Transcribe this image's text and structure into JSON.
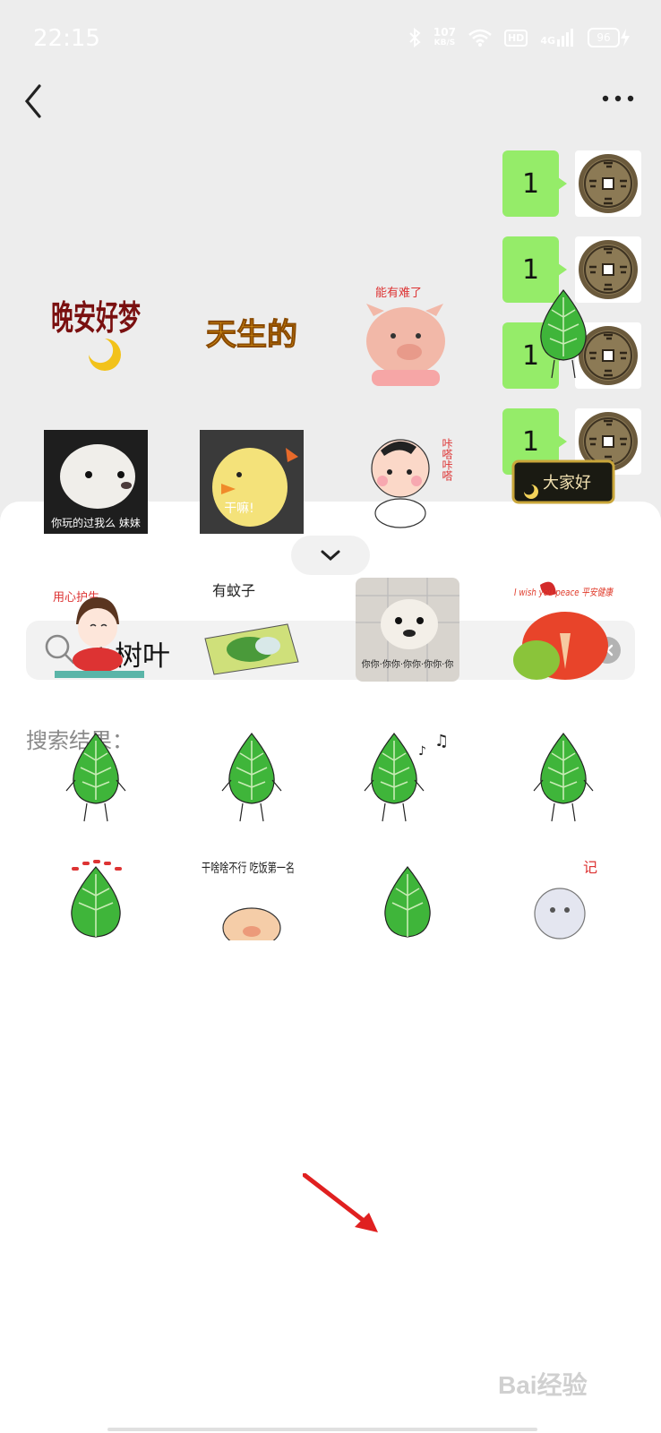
{
  "status_bar": {
    "time": "22:15",
    "net_speed": "107",
    "net_unit": "KB/S",
    "hd": "HD",
    "signal": "4G",
    "battery": "96"
  },
  "chat": {
    "messages": [
      {
        "text": "1"
      },
      {
        "text": "1"
      },
      {
        "text": "1"
      },
      {
        "text": "1"
      }
    ]
  },
  "sticker_panel": {
    "search_query": "小树叶",
    "results_label": "搜索结果：",
    "stickers": [
      {
        "text": "晚安好梦"
      },
      {
        "text": "天生的"
      },
      {
        "text": "能有难了"
      },
      {
        "text": ""
      },
      {
        "text": "你玩的过我么 妹妹"
      },
      {
        "text": "干嘛!"
      },
      {
        "text": "咔嗒咔嗒"
      },
      {
        "text": "大家好"
      },
      {
        "text": "用心护生"
      },
      {
        "text": "有蚊子"
      },
      {
        "text": "你你·你你·你你·你你·你"
      },
      {
        "text": "I wish you peace 平安健康"
      },
      {
        "text": ""
      },
      {
        "text": ""
      },
      {
        "text": ""
      },
      {
        "text": ""
      },
      {
        "text": ""
      },
      {
        "text": "干啥啥不行 吃饭第一名"
      },
      {
        "text": ""
      },
      {
        "text": "记"
      }
    ]
  },
  "watermark": "Bai经验",
  "colors": {
    "bubble": "#95ec69",
    "chat_bg": "#ededed",
    "leaf": "#3fb53a",
    "arrow": "#e02020"
  }
}
